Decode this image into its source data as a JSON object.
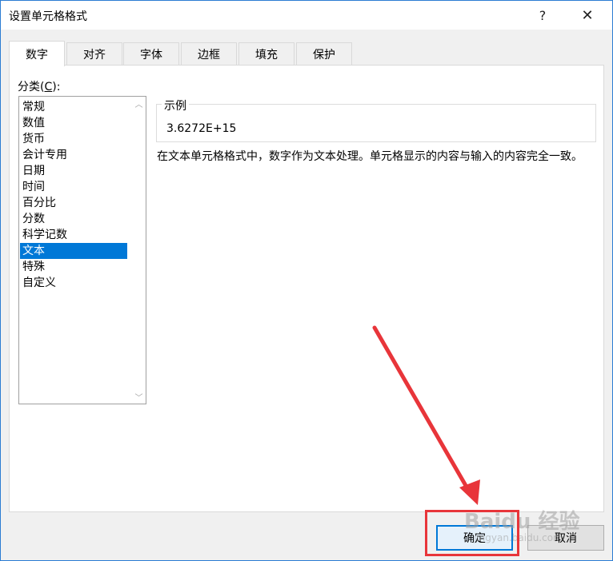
{
  "window": {
    "title": "设置单元格格式",
    "help_glyph": "?",
    "close_glyph": "✕"
  },
  "tabs": [
    {
      "label": "数字",
      "active": true
    },
    {
      "label": "对齐",
      "active": false
    },
    {
      "label": "字体",
      "active": false
    },
    {
      "label": "边框",
      "active": false
    },
    {
      "label": "填充",
      "active": false
    },
    {
      "label": "保护",
      "active": false
    }
  ],
  "category": {
    "label_prefix": "分类(",
    "label_key": "C",
    "label_suffix": "):",
    "items": [
      "常规",
      "数值",
      "货币",
      "会计专用",
      "日期",
      "时间",
      "百分比",
      "分数",
      "科学记数",
      "文本",
      "特殊",
      "自定义"
    ],
    "selected": "文本"
  },
  "sample": {
    "legend": "示例",
    "value": "3.6272E+15"
  },
  "description": "在文本单元格格式中，数字作为文本处理。单元格显示的内容与输入的内容完全一致。",
  "buttons": {
    "ok": "确定",
    "cancel": "取消"
  },
  "watermark": {
    "text": "Baidu 经验",
    "sub": "jingyan.baidu.com"
  },
  "colors": {
    "accent": "#0078d7",
    "annotation": "#e8353a"
  }
}
